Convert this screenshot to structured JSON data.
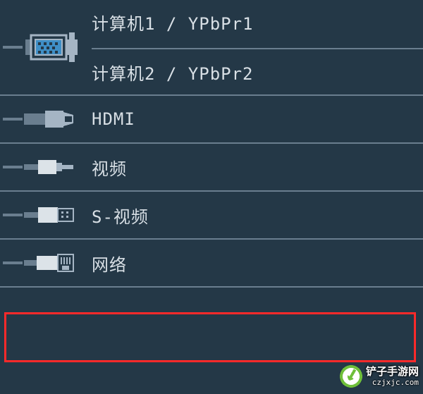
{
  "menu": {
    "items": [
      {
        "id": "computer",
        "label1": "计算机1 / YPbPr1",
        "label2": "计算机2 / YPbPr2"
      },
      {
        "id": "hdmi",
        "label": "HDMI"
      },
      {
        "id": "video",
        "label": "视频"
      },
      {
        "id": "svideo",
        "label": "S-视频"
      },
      {
        "id": "network",
        "label": "网络"
      }
    ],
    "highlighted_index": 4
  },
  "watermark": {
    "brand": "铲子手游网",
    "url": "czjxjc.com"
  }
}
